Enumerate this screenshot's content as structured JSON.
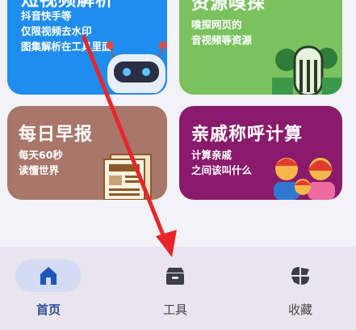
{
  "cards": [
    {
      "title": "短视频解析",
      "desc": [
        "抖音快手等",
        "仅限视频去水印",
        "图集解析在工具里面"
      ],
      "color": "#1f8df0",
      "icon": "robot-icon"
    },
    {
      "title": "资源嗅探",
      "desc": [
        "嗅探网页的",
        "音视频等资源"
      ],
      "color": "#79c25e",
      "icon": "web-resource-icon"
    },
    {
      "title": "每日早报",
      "desc": [
        "每天60秒",
        "读懂世界"
      ],
      "color": "#a8776a",
      "icon": "newspaper-icon"
    },
    {
      "title": "亲戚称呼计算",
      "desc": [
        "计算亲戚",
        "之间该叫什么"
      ],
      "color": "#8a1a6b",
      "icon": "family-icon"
    }
  ],
  "nav": {
    "home": {
      "label": "首页",
      "icon": "home-icon",
      "active": true
    },
    "tools": {
      "label": "工具",
      "icon": "toolbox-icon"
    },
    "favorites": {
      "label": "收藏",
      "icon": "favorites-icon"
    }
  },
  "colors": {
    "nav_bg": "#e9e5ef",
    "nav_active_pill": "#d3dbf5",
    "active_label": "#2b4f99",
    "arrow": "#e8262a"
  }
}
